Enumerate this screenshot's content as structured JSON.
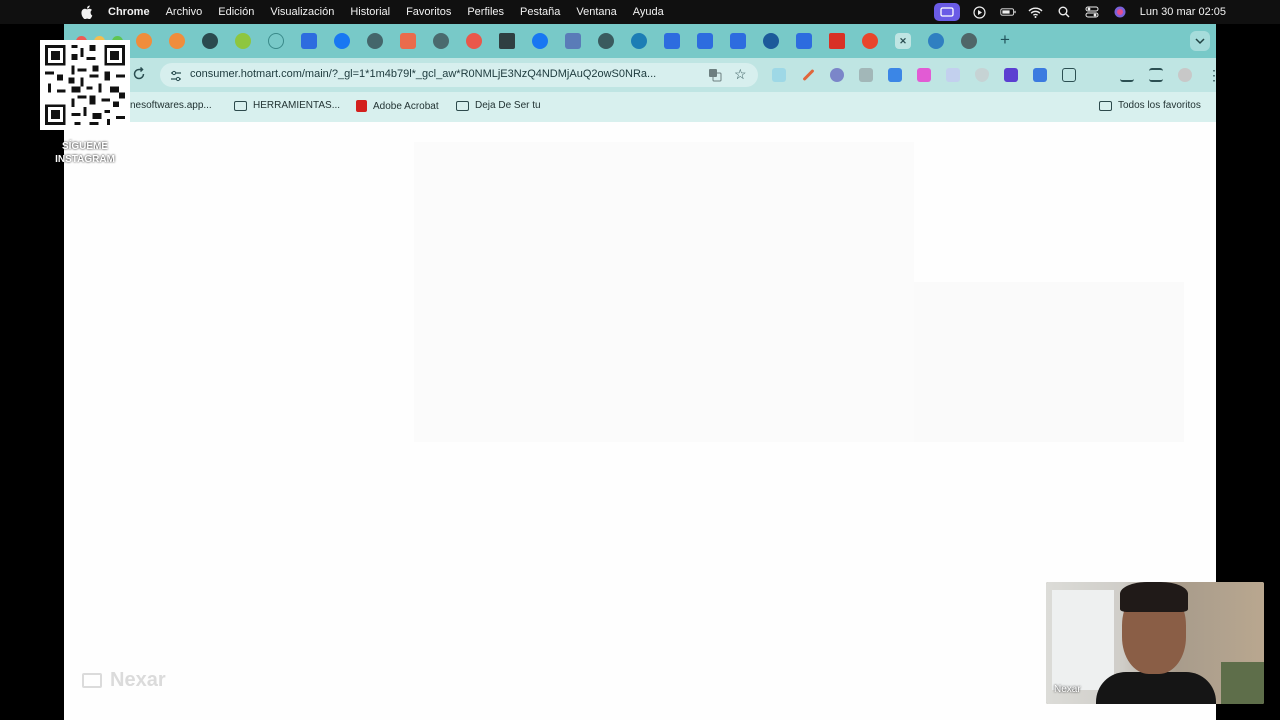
{
  "menubar": {
    "app": "Chrome",
    "items": [
      "Archivo",
      "Edición",
      "Visualización",
      "Historial",
      "Favoritos",
      "Perfiles",
      "Pestaña",
      "Ventana",
      "Ayuda"
    ],
    "clock": "Lun 30 mar  02:05"
  },
  "browser": {
    "url": "consumer.hotmart.com/main/?_gl=1*1m4b79l*_gcl_aw*R0NMLjE3NzQ4NDMjAuQ2owS0NRa...",
    "bookmarks": [
      {
        "label": "nesoftwares.app...",
        "icon": "none"
      },
      {
        "label": "HERRAMIENTAS...",
        "icon": "folder-icon"
      },
      {
        "label": "Adobe Acrobat",
        "icon": "pdf-icon"
      },
      {
        "label": "Deja De Ser tu",
        "icon": "folder-icon"
      }
    ],
    "all_bookmarks": "Todos los favoritos"
  },
  "overlays": {
    "qr_caption_1": "SÍGUEME",
    "qr_caption_2": "INSTAGRAM",
    "watermark": "Nexar",
    "webcam_name": "Nexar"
  },
  "colors": {
    "tabstrip": "#78c9c8",
    "toolbar": "#bfe5e3",
    "bookmarks_bar": "#d8f0ee",
    "status_cast": "#6a5be6"
  }
}
